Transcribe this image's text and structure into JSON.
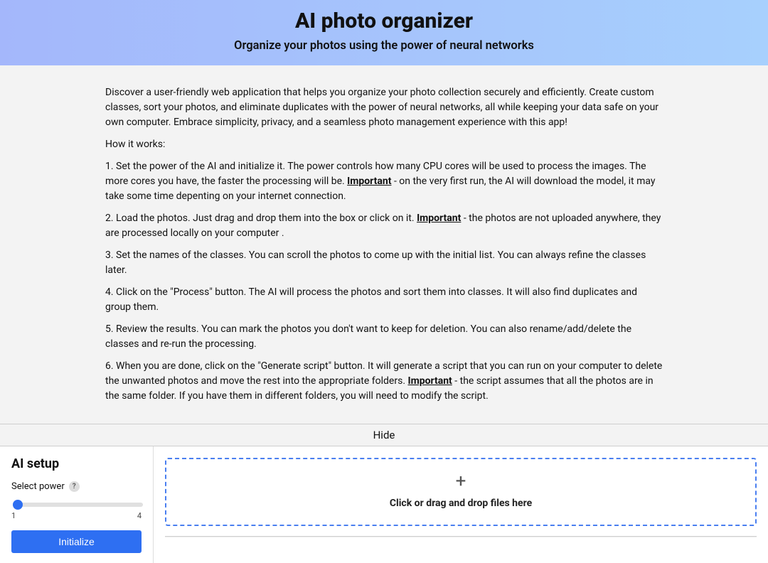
{
  "hero": {
    "title": "AI photo organizer",
    "subtitle": "Organize your photos using the power of neural networks"
  },
  "intro": {
    "blurb": "Discover a user-friendly web application that helps you organize your photo collection securely and efficiently. Create custom classes, sort your photos, and eliminate duplicates with the power of neural networks, all while keeping your data safe on your own computer. Embrace simplicity, privacy, and a seamless photo management experience with this app!",
    "how_header": "How it works:",
    "important_label": "Important",
    "step1a": "1. Set the power of the AI and initialize it. The power controls how many CPU cores will be used to process the images. The more cores you have, the faster the processing will be. ",
    "step1b": " - on the very first run, the AI will download the model, it may take some time depenting on your internet connection.",
    "step2a": "2. Load the photos. Just drag and drop them into the box or click on it. ",
    "step2b": " - the photos are not uploaded anywhere, they are processed locally on your computer .",
    "step3": "3. Set the names of the classes. You can scroll the photos to come up with the initial list. You can always refine the classes later.",
    "step4": "4. Click on the \"Process\" button. The AI will process the photos and sort them into classes. It will also find duplicates and group them.",
    "step5": "5. Review the results. You can mark the photos you don't want to keep for deletion. You can also rename/add/delete the classes and re-run the processing.",
    "step6a": "6. When you are done, click on the \"Generate script\" button. It will generate a script that you can run on your computer to delete the unwanted photos and move the rest into the appropriate folders. ",
    "step6b": " - the script assumes that all the photos are in the same folder. If you have them in different folders, you will need to modify the script."
  },
  "hide_label": "Hide",
  "setup": {
    "heading": "AI setup",
    "select_power_label": "Select power",
    "help_glyph": "?",
    "slider_min": "1",
    "slider_max": "4",
    "slider_value": "1",
    "init_button": "Initialize"
  },
  "dropzone": {
    "plus_glyph": "+",
    "text": "Click or drag and drop files here"
  }
}
